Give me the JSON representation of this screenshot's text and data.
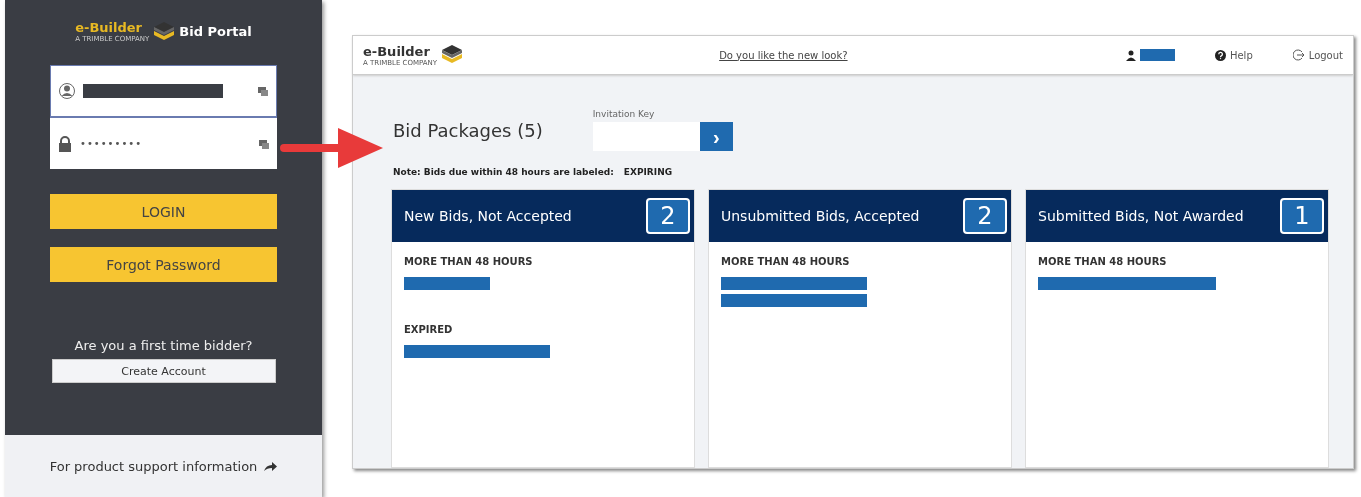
{
  "login_panel": {
    "logo": {
      "brand": "e-Builder",
      "tagline": "A TRIMBLE COMPANY",
      "product": "Bid Portal"
    },
    "username_field": {
      "kind": "redacted"
    },
    "password_field": {
      "value": "•••••••••"
    },
    "buttons": [
      "LOGIN",
      "Forgot Password"
    ],
    "signup_prompt": "Are you a first time bidder?",
    "create_account_button": "Create Account",
    "footer_link": "For product support information"
  },
  "portal": {
    "header": {
      "logo": {
        "brand": "e-Builder",
        "tagline": "A TRIMBLE COMPANY"
      },
      "feedback_link": "Do you like the new look?",
      "user": {
        "kind": "redacted"
      },
      "help": "Help",
      "logout": "Logout"
    },
    "title": "Bid Packages (5)",
    "invitation_key": {
      "label": "Invitation Key",
      "submit": "›"
    },
    "note": {
      "text": "Note: Bids due within 48 hours are labeled:",
      "label": "EXPIRING"
    },
    "cards": [
      {
        "title": "New Bids, Not Accepted",
        "count": "2",
        "groups": [
          {
            "heading": "MORE THAN 48 HOURS",
            "entries": [
              {
                "kind": "redacted"
              }
            ]
          },
          {
            "heading": "EXPIRED",
            "entries": [
              {
                "kind": "redacted"
              }
            ]
          }
        ]
      },
      {
        "title": "Unsubmitted Bids, Accepted",
        "count": "2",
        "groups": [
          {
            "heading": "MORE THAN 48 HOURS",
            "entries": [
              {
                "kind": "redacted"
              },
              {
                "kind": "redacted"
              }
            ]
          }
        ]
      },
      {
        "title": "Submitted Bids, Not Awarded",
        "count": "1",
        "groups": [
          {
            "heading": "MORE THAN 48 HOURS",
            "entries": [
              {
                "kind": "redacted"
              }
            ]
          }
        ]
      }
    ]
  }
}
